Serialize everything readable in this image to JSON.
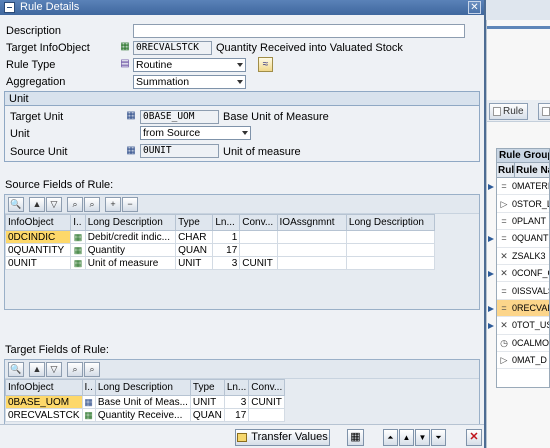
{
  "dialog": {
    "title": "Rule Details"
  },
  "form": {
    "description_label": "Description",
    "description_value": "",
    "target_infoobject_label": "Target InfoObject",
    "target_infoobject_value": "0RECVALSTCK",
    "target_infoobject_text": "Quantity Received into Valuated Stock",
    "rule_type_label": "Rule Type",
    "rule_type_value": "Routine",
    "aggregation_label": "Aggregation",
    "aggregation_value": "Summation"
  },
  "unit_group": {
    "title": "Unit",
    "target_unit_label": "Target Unit",
    "target_unit_value": "0BASE_UOM",
    "target_unit_text": "Base Unit of Measure",
    "unit_label": "Unit",
    "unit_value": "from Source",
    "source_unit_label": "Source Unit",
    "source_unit_value": "0UNIT",
    "source_unit_text": "Unit of measure"
  },
  "source_fields": {
    "label": "Source Fields of Rule:",
    "columns": [
      "InfoObject",
      "I..",
      "Long Description",
      "Type",
      "Ln...",
      "Conv...",
      "IOAssgnmnt",
      "Long Description"
    ],
    "rows": [
      {
        "infoobject": "0DCINDIC",
        "desc": "Debit/credit indic...",
        "type": "CHAR",
        "len": "1",
        "conv": "",
        "selected": true
      },
      {
        "infoobject": "0QUANTITY",
        "desc": "Quantity",
        "type": "QUAN",
        "len": "17",
        "conv": "",
        "selected": false
      },
      {
        "infoobject": "0UNIT",
        "desc": "Unit of measure",
        "type": "UNIT",
        "len": "3",
        "conv": "CUNIT",
        "selected": false
      }
    ]
  },
  "target_fields": {
    "label": "Target Fields of Rule:",
    "columns": [
      "InfoObject",
      "I..",
      "Long Description",
      "Type",
      "Ln...",
      "Conv..."
    ],
    "rows": [
      {
        "infoobject": "0BASE_UOM",
        "desc": "Base Unit of Meas...",
        "type": "UNIT",
        "len": "3",
        "conv": "CUNIT",
        "selected": true
      },
      {
        "infoobject": "0RECVALSTCK",
        "desc": "Quantity Receive...",
        "type": "QUAN",
        "len": "17",
        "conv": "",
        "selected": false
      }
    ]
  },
  "bottom": {
    "transfer_values": "Transfer Values"
  },
  "background": {
    "rule_button": "Rule",
    "rule_group_header": "Rule Group:",
    "col_rule": "Rul",
    "col_rule_name": "Rule Na",
    "items": [
      "0MATERI",
      "0STOR_L",
      "0PLANT",
      "0QUANT",
      "ZSALK3",
      "0CONF_G",
      "0ISSVALS",
      "0RECVAL",
      "0TOT_US",
      "0CALMO",
      "0MAT_D"
    ]
  }
}
